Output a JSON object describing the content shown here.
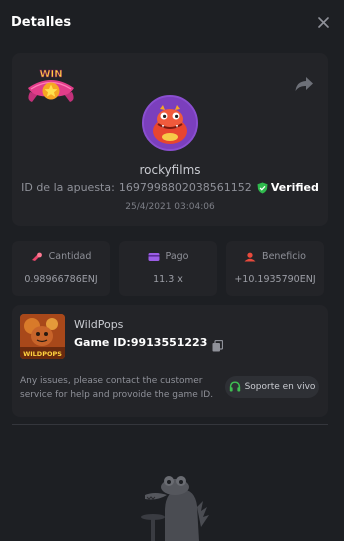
{
  "header": {
    "title": "Detalles"
  },
  "bet": {
    "badge_text": "WIN",
    "username": "rockyfilms",
    "bet_id_label": "ID de la apuesta:",
    "bet_id": "1697998802038561152",
    "verified_label": "Verified",
    "timestamp": "25/4/2021 03:04:06"
  },
  "stats": [
    {
      "label": "Cantidad",
      "value": "0.98966786ENJ",
      "icon": "coins-icon",
      "color": "#e8466b"
    },
    {
      "label": "Pago",
      "value": "11.3 x",
      "icon": "card-icon",
      "color": "#9b5de5"
    },
    {
      "label": "Beneficio",
      "value": "+10.1935790ENJ",
      "icon": "profit-icon",
      "color": "#e84a3c"
    }
  ],
  "game": {
    "name": "WildPops",
    "thumb_label": "WILDPOPS",
    "id_label": "Game ID:",
    "id_value": "9913551223",
    "help_text": "Any issues, please contact the customer service for help and provoide the game ID.",
    "support_label": "Soporte en vivo"
  },
  "colors": {
    "background": "#1d1f23",
    "card": "#232428",
    "verified": "#2fb94d",
    "support_icon": "#3fbf52"
  }
}
